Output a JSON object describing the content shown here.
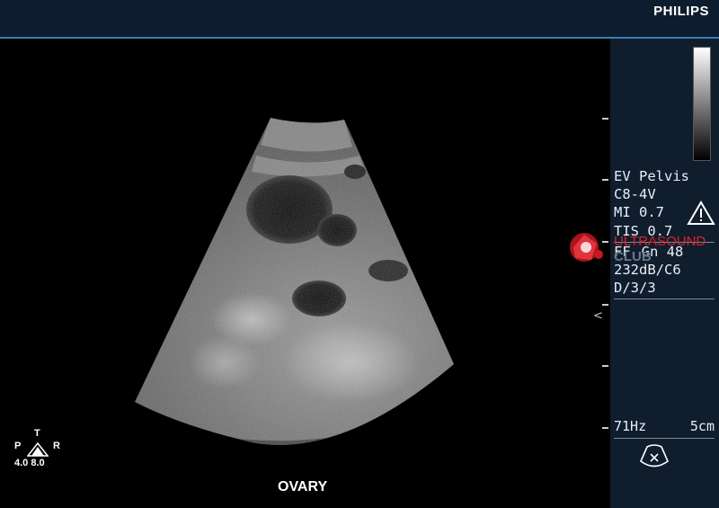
{
  "header": {
    "brand": "PHILIPS"
  },
  "image": {
    "label": "OVARY"
  },
  "orientation": {
    "top": "T",
    "left": "P",
    "right": "R",
    "values": "4.0 8.0"
  },
  "params": {
    "preset": "EV Pelvis",
    "probe": "C8-4V",
    "mi": "MI 0.7",
    "tis": "TIS 0.7",
    "gain_mode": "FF",
    "gain": "Gn 48",
    "dynamic": "232dB/C6",
    "map": "D/3/3"
  },
  "bottom": {
    "frame_rate": "71Hz",
    "depth": "5cm"
  },
  "watermark": {
    "line1": "ULTRASOUND",
    "line2": "CLUB"
  },
  "colors": {
    "topbar": "#0d1c2e",
    "panel": "#0f1d2d",
    "accent_line": "#3d7fb0",
    "watermark_red": "#e0202a"
  },
  "icons": {
    "warning": "warning-icon",
    "probe": "probe-icon",
    "logo": "ultrasound-club-logo"
  }
}
